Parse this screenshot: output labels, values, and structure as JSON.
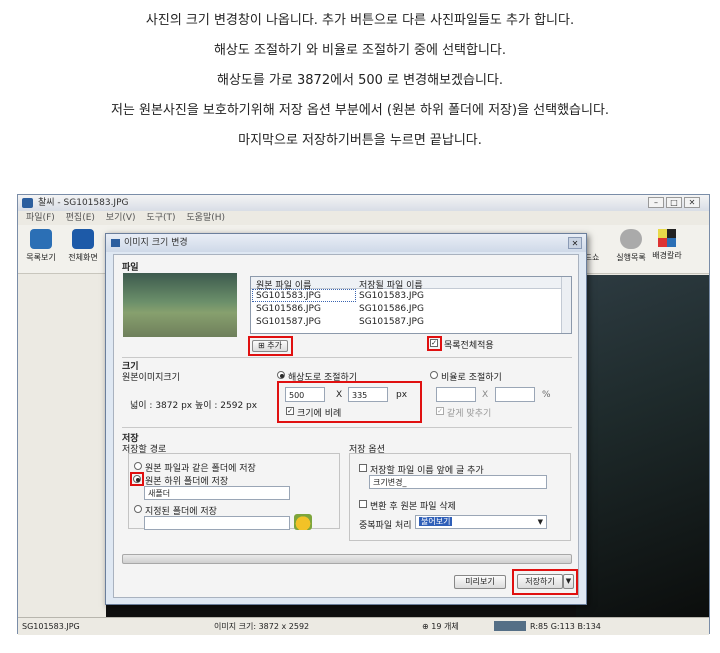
{
  "captions": [
    "사진의 크기 변경창이 나옵니다. 추가 버튼으로 다른 사진파일들도 추가 합니다.",
    "해상도 조절하기 와 비율로 조절하기 중에 선택합니다.",
    "해상도를 가로 3872에서 500 로 변경해보겠습니다.",
    "저는 원본사진을 보호하기위해  저장 옵션 부분에서 (원본 하위 폴더에 저장)을 선택했습니다.",
    "마지막으로 저장하기버튼을 누르면 끝납니다."
  ],
  "app": {
    "title": "찰씨 - SG101583.JPG",
    "menu": [
      "파일(F)",
      "편집(E)",
      "보기(V)",
      "도구(T)",
      "도움말(H)"
    ],
    "toolbar_left": [
      "목록보기",
      "전체화면"
    ],
    "toolbar_right": [
      "배경칼라"
    ],
    "toolbar_partial": [
      "슬라이드쇼",
      "실행목록"
    ],
    "status": {
      "filename": "SG101583.JPG",
      "image_size": "이미지 크기: 3872 x 2592",
      "count": "19 개체",
      "rgb": "R:85 G:113 B:134"
    }
  },
  "dialog": {
    "title": "이미지 크기 변경",
    "file_section": "파일",
    "columns": [
      "원본 파일 이름",
      "저장될 파일 이름"
    ],
    "files": [
      {
        "original": "SG101583.JPG",
        "saved": "SG101583.JPG"
      },
      {
        "original": "SG101586.JPG",
        "saved": "SG101586.JPG"
      },
      {
        "original": "SG101587.JPG",
        "saved": "SG101587.JPG"
      }
    ],
    "add_button": "추가",
    "apply_all_label": "목록전체적용",
    "size_section": "크기",
    "original_size_label": "원본이미지크기",
    "original_size_value": "넓이 :   3872 px  높이 :  2592 px",
    "resolution_radio": "해상도로 조절하기",
    "ratio_radio": "비율로 조절하기",
    "width_value": "500",
    "height_value": "335",
    "times": "X",
    "px_unit": "px",
    "percent_unit": "%",
    "keep_ratio_label": "크기에 비례",
    "equal_label": "같게 맞추기",
    "save_section": "저장",
    "save_path_label": "저장할 경로",
    "path_options": [
      "원본 파일과 같은 폴더에 저장",
      "원본 하위 폴더에 저장",
      "지정된 폴더에 저장"
    ],
    "subfolder_value": "새폴더",
    "save_options_label": "저장 옵션",
    "prefix_label": "저장할 파일 이름 앞에 글 추가",
    "prefix_value": "크기변경_",
    "delete_original_label": "변환 후 원본 파일 삭제",
    "duplicate_label": "중복파일 처리",
    "duplicate_value": "물어보기",
    "preview_button": "미리보기",
    "save_button": "저장하기"
  }
}
